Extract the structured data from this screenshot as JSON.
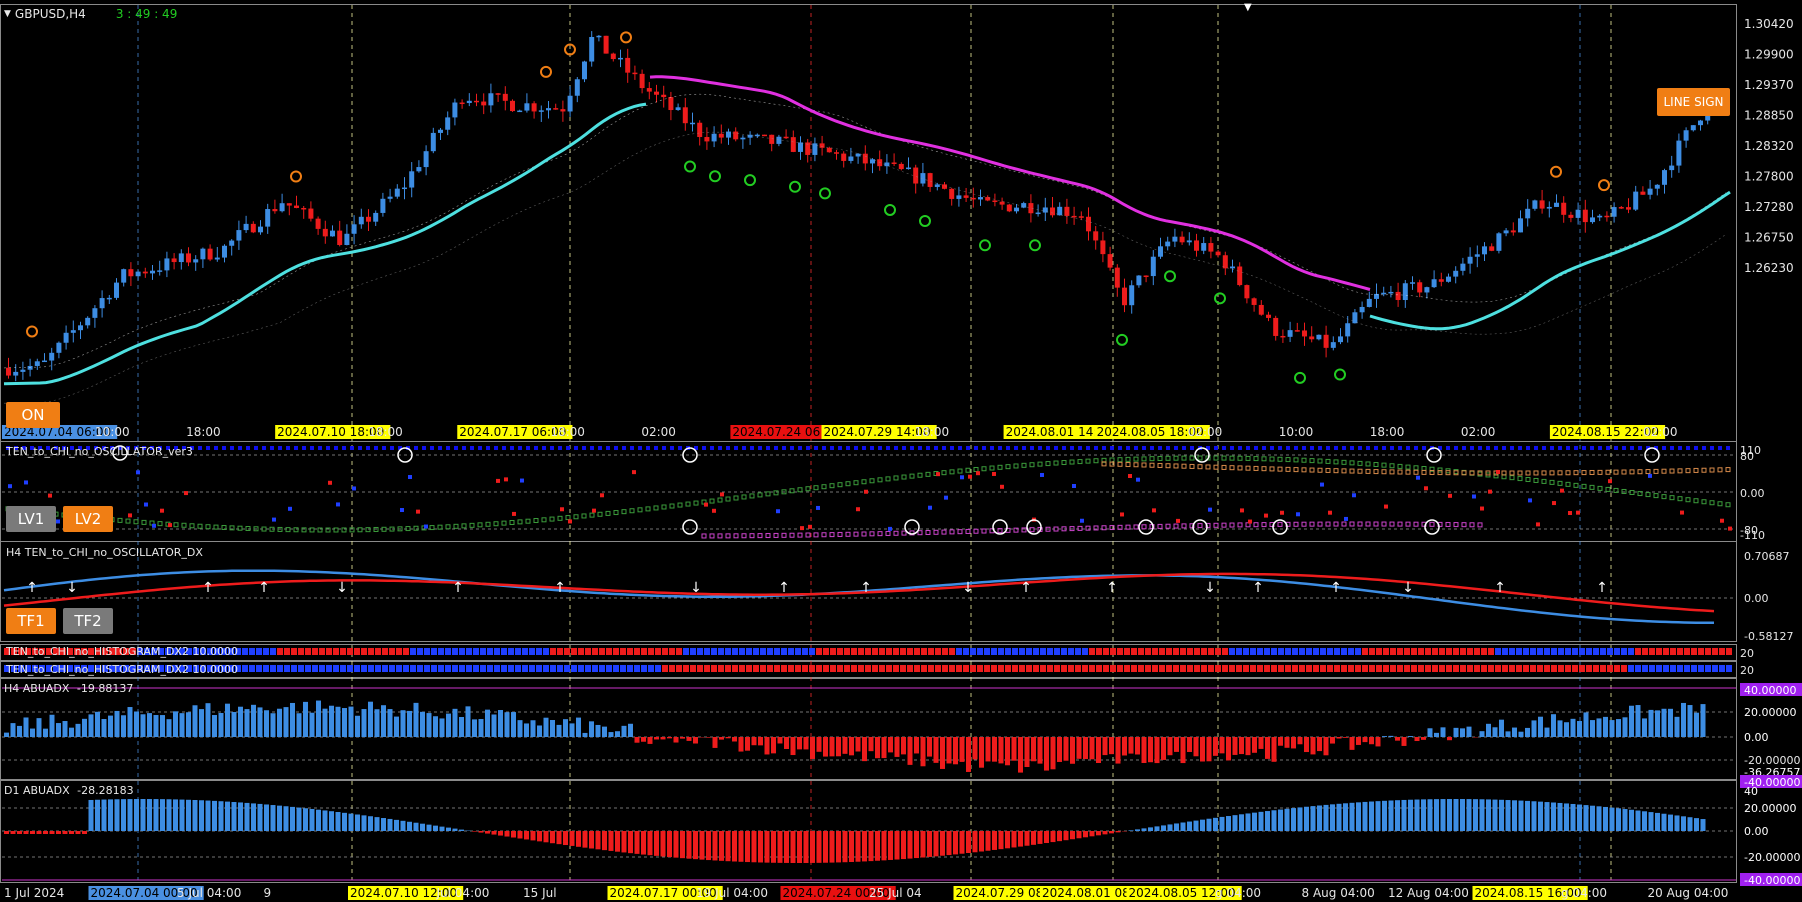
{
  "chart": {
    "symbol_label": "GBPUSD,H4",
    "countdown": "3 : 49 : 49",
    "price_labels": [
      "1.30420",
      "1.29900",
      "1.29370",
      "1.28850",
      "1.28320",
      "1.27800",
      "1.27280",
      "1.26750",
      "1.26230"
    ],
    "price_range": [
      1.2607,
      1.3062
    ],
    "ma_badge": "LINE SIGN",
    "on_button": "ON"
  },
  "time_axis_top": [
    {
      "text": "2024.07.04 06:00",
      "bg": "#4a90e2"
    },
    {
      "text": "10:00"
    },
    {
      "text": "18:00"
    },
    {
      "text": "2024.07.10 18:00",
      "bg": "#ffff00"
    },
    {
      "text": "18:00"
    },
    {
      "text": "2024.07.17 06:00",
      "bg": "#ffff00"
    },
    {
      "text": "18:00"
    },
    {
      "text": "02:00"
    },
    {
      "text": "2024.07.24 06:00",
      "bg": "#e81010"
    },
    {
      "text": "2024.07.29 14:00",
      "bg": "#ffff00"
    },
    {
      "text": "18:00"
    },
    {
      "text": "2024.08.01 14:00",
      "bg": "#ffff00"
    },
    {
      "text": "2024.08.05 18:00",
      "bg": "#ffff00"
    },
    {
      "text": "02:00"
    },
    {
      "text": "10:00"
    },
    {
      "text": "18:00"
    },
    {
      "text": "02:00"
    },
    {
      "text": "2024.08.15 22:00",
      "bg": "#ffff00"
    },
    {
      "text": "02:00"
    }
  ],
  "time_axis_bottom": [
    {
      "text": "1 Jul 2024"
    },
    {
      "text": "2024.07.04 00:00",
      "bg": "#4a90e2"
    },
    {
      "text": "5 Jul 04:00"
    },
    {
      "text": "9"
    },
    {
      "text": "2024.07.10 12:00",
      "bg": "#ffff00"
    },
    {
      "text": "Jul 04:00"
    },
    {
      "text": "15 Jul"
    },
    {
      "text": "2024.07.17 00:00",
      "bg": "#ffff00"
    },
    {
      "text": "19 Jul 04:00"
    },
    {
      "text": "2024.07.24 00:00",
      "bg": "#e81010"
    },
    {
      "text": "25 Jul 04"
    },
    {
      "text": "2024.07.29 08:00",
      "bg": "#ffff00"
    },
    {
      "text": "2024.08.01 08:00",
      "bg": "#ffff00"
    },
    {
      "text": "2024.08.05 12:00",
      "bg": "#ffff00"
    },
    {
      "text": "g 04:00"
    },
    {
      "text": "8 Aug 04:00"
    },
    {
      "text": "12 Aug 04:00"
    },
    {
      "text": "2024.08.15 16:00",
      "bg": "#ffff00"
    },
    {
      "text": "g 04:00"
    },
    {
      "text": "20 Aug 04:00"
    }
  ],
  "oscillator_panel": {
    "title": "TEN_to_CHI_no_OSCILLATOR_ver3",
    "levels": [
      "110",
      "80",
      "0.00",
      "-80",
      "-110"
    ],
    "lv1": "LV1",
    "lv2": "LV2"
  },
  "dx_panel": {
    "title": "H4 TEN_to_CHI_no_OSCILLATOR_DX",
    "levels": [
      "0.70687",
      "0.00",
      "-0.58127"
    ],
    "tf1": "TF1",
    "tf2": "TF2"
  },
  "histogram_panels": [
    {
      "title": "TEN_to_CHI_no_HISTOGRAM_DX2 10.0000",
      "right": "20"
    },
    {
      "title": "TEN_to_CHI_no_HISTOGRAM_DX2 10.0000",
      "right": "20"
    }
  ],
  "h4_abuadx": {
    "title": "H4 ABUADX",
    "value": "-19.88137",
    "levels": [
      "40.00000",
      "20.00000",
      "0.00",
      "-20.00000",
      "-36.26757",
      "-40.00000"
    ]
  },
  "d1_abuadx": {
    "title": "D1 ABUADX",
    "value": "-28.28183",
    "levels": [
      "40",
      "20.00000",
      "0.00",
      "-20.00000",
      "-40.00000"
    ]
  },
  "colors": {
    "bull": "#3d8de3",
    "bear": "#ee1c1c",
    "ma_fast": "#4ee0e0",
    "ma_slow": "#e030e0",
    "orange": "#f07e14",
    "gray_btn": "#7a7a7a"
  },
  "icons": [
    "triangle-down-icon",
    "scroll-marker-icon",
    "arrow-up-icon",
    "arrow-down-icon",
    "circle-number-icon",
    "target-circle-icon"
  ]
}
